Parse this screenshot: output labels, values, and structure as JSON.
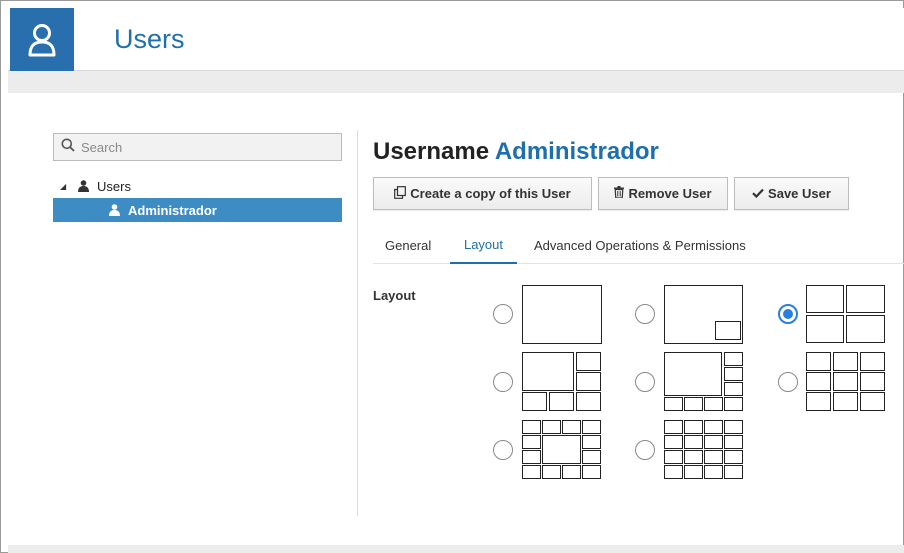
{
  "header": {
    "title": "Users",
    "icon": "user-icon",
    "accent": "#2a6fad"
  },
  "search": {
    "placeholder": "Search"
  },
  "tree": {
    "root_label": "Users",
    "items": [
      {
        "label": "Administrador",
        "selected": true
      }
    ]
  },
  "detail": {
    "heading_prefix": "Username",
    "username": "Administrador",
    "buttons": {
      "copy": "Create a copy of this User",
      "remove": "Remove User",
      "save": "Save User"
    },
    "tabs": [
      {
        "label": "General",
        "active": false
      },
      {
        "label": "Layout",
        "active": true
      },
      {
        "label": "Advanced Operations & Permissions",
        "active": false
      }
    ],
    "layout_label": "Layout",
    "layout_options": [
      {
        "name": "single",
        "selected": false
      },
      {
        "name": "picture-in-picture",
        "selected": false
      },
      {
        "name": "grid-2x2",
        "selected": true
      },
      {
        "name": "1-plus-5",
        "selected": false
      },
      {
        "name": "1-plus-7",
        "selected": false
      },
      {
        "name": "grid-3x3",
        "selected": false
      },
      {
        "name": "1-plus-12",
        "selected": false
      },
      {
        "name": "grid-4x4",
        "selected": false
      }
    ]
  }
}
